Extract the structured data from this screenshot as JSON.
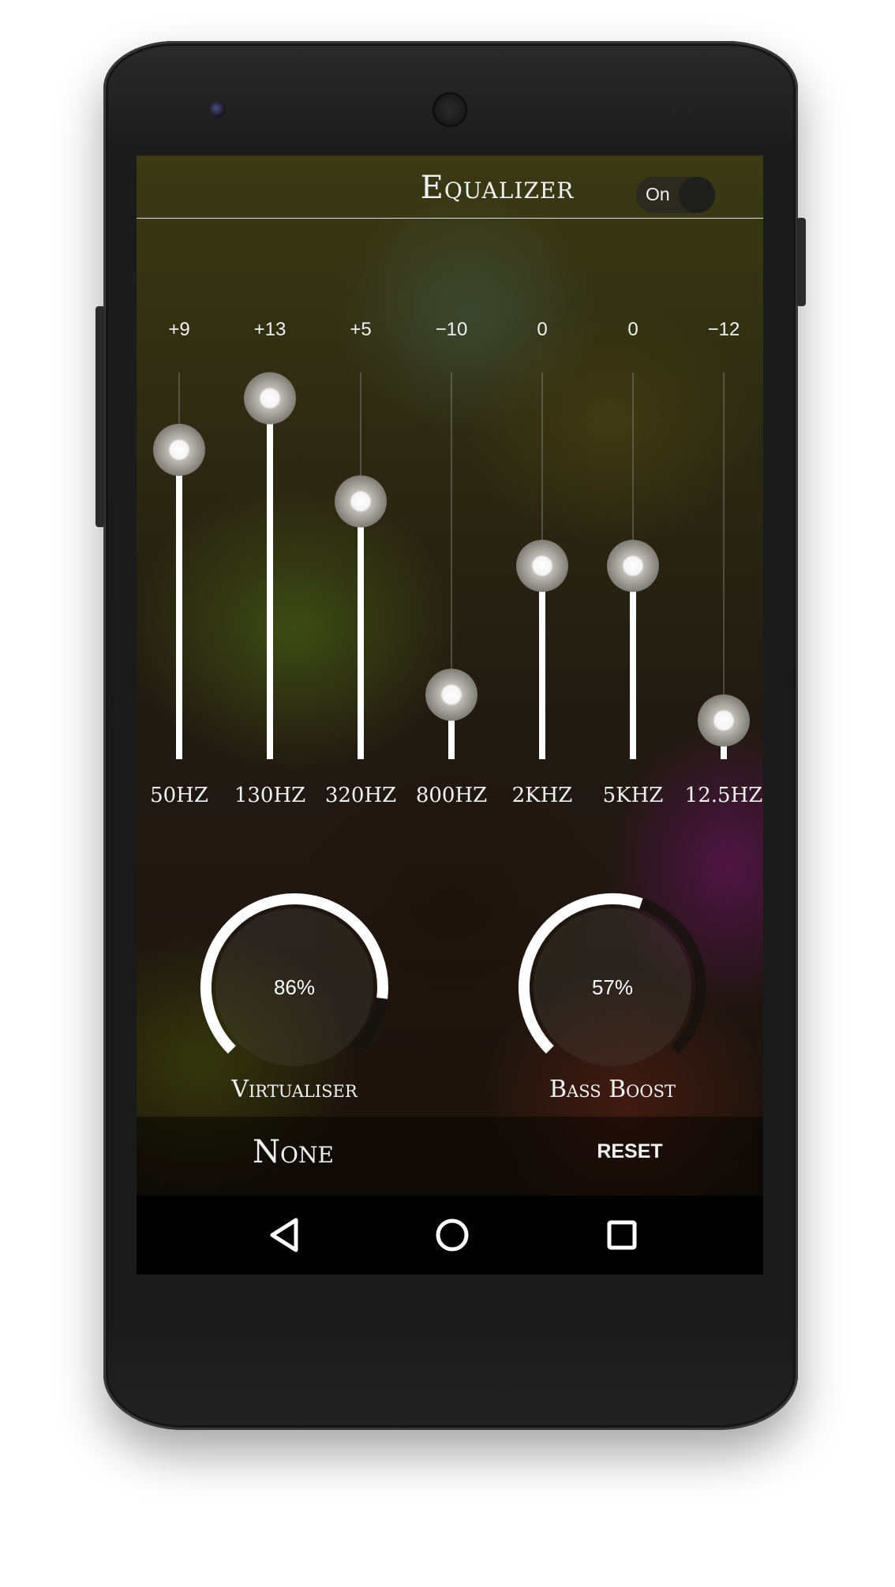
{
  "header": {
    "title": "Equalizer",
    "toggle_label": "On"
  },
  "eq": {
    "bands": [
      {
        "freq": "50HZ",
        "value": 9,
        "value_label": "+9"
      },
      {
        "freq": "130HZ",
        "value": 13,
        "value_label": "+13"
      },
      {
        "freq": "320HZ",
        "value": 5,
        "value_label": "+5"
      },
      {
        "freq": "800HZ",
        "value": -10,
        "value_label": "−10"
      },
      {
        "freq": "2KHZ",
        "value": 0,
        "value_label": "0"
      },
      {
        "freq": "5KHZ",
        "value": 0,
        "value_label": "0"
      },
      {
        "freq": "12.5HZ",
        "value": -12,
        "value_label": "−12"
      }
    ],
    "range": [
      -15,
      15
    ]
  },
  "effects": {
    "virtualiser": {
      "label": "Virtualiser",
      "value_text": "86%",
      "value": 86
    },
    "bass_boost": {
      "label": "Bass Boost",
      "value_text": "57%",
      "value": 57
    }
  },
  "bottom": {
    "preset": "None",
    "reset_label": "RESET"
  },
  "nav": {
    "icons": [
      "back-icon",
      "home-icon",
      "recents-icon"
    ]
  },
  "colors": {
    "accent": "#ffffff",
    "track_dim": "#8a8a80",
    "knob": "#8e8c84"
  }
}
